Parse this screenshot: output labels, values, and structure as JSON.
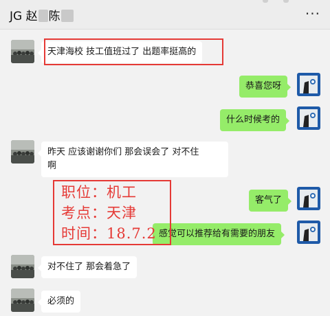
{
  "header": {
    "title_prefix": "JG 赵",
    "title_mid": "陈",
    "more_icon": "more-dots-icon",
    "more_glyph": "···"
  },
  "messages": [
    {
      "side": "in",
      "text": "天津海校  技工值班过了   出题率挺高的"
    },
    {
      "side": "out",
      "text": "恭喜您呀"
    },
    {
      "side": "out",
      "text": "什么时候考的"
    },
    {
      "side": "in",
      "line1": "昨天   应该谢谢你们  那会误会了  对不住",
      "line2": "啊"
    },
    {
      "side": "out",
      "text": "客气了"
    },
    {
      "side": "out",
      "text": "感觉可以推荐给有需要的朋友"
    },
    {
      "side": "in",
      "text": "对不住了   那会着急了"
    },
    {
      "side": "in",
      "text": "必须的"
    }
  ],
  "overlay": {
    "line1": "职位：机工",
    "line2": "考点：天津",
    "line3": "时间：18.7.2"
  },
  "colors": {
    "outgoing_bubble": "#95ec69",
    "incoming_bubble": "#ffffff",
    "highlight_red": "#e53935",
    "background": "#f2f2f2"
  }
}
